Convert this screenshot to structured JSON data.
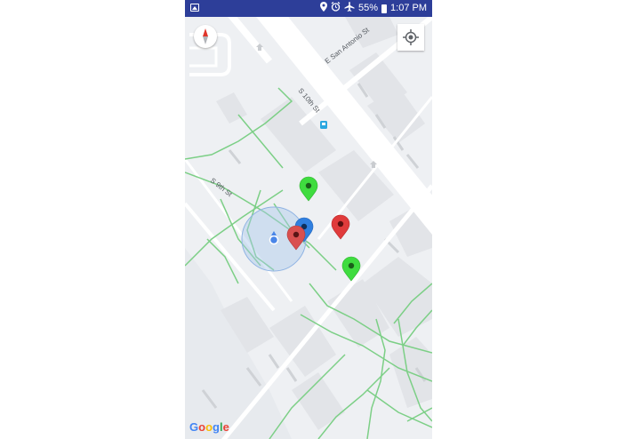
{
  "status_bar": {
    "battery": "55%",
    "time": "1:07 PM",
    "icons": [
      "gallery-icon",
      "location-icon",
      "alarm-icon",
      "airplane-icon",
      "battery-icon"
    ]
  },
  "map": {
    "street_labels": {
      "san_antonio": "E San Antonio St",
      "tenth": "S 10th St",
      "ninth": "S 9th St"
    },
    "attribution": [
      "G",
      "o",
      "o",
      "g",
      "l",
      "e"
    ],
    "attribution_colors": [
      "#4285f4",
      "#ea4335",
      "#fbbc05",
      "#4285f4",
      "#34a853",
      "#ea4335"
    ],
    "markers": [
      {
        "name": "green-marker-1",
        "color": "#3fdc3f"
      },
      {
        "name": "blue-marker",
        "color": "#2f7fe0"
      },
      {
        "name": "red-marker-1",
        "color": "#e03b3b"
      },
      {
        "name": "red-marker-2",
        "color": "#d95050"
      },
      {
        "name": "green-marker-2",
        "color": "#3fdc3f"
      }
    ],
    "colors": {
      "road": "#ffffff",
      "path": "#7ccf86",
      "building": "#e3e5e8",
      "accuracy_circle": "#a9c8ec",
      "my_location": "#4a86e8"
    }
  }
}
